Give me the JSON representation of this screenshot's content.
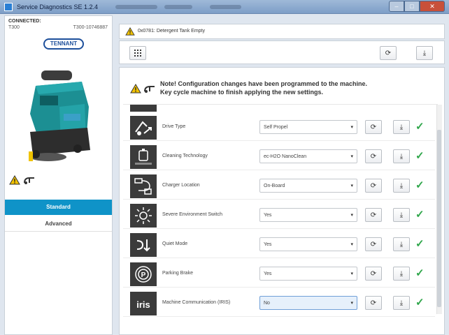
{
  "window": {
    "title": "Service Diagnostics SE 1.2.4"
  },
  "connection": {
    "label": "CONNECTED:",
    "model": "T300",
    "serial": "T300-10746887"
  },
  "brand": {
    "logo_text": "TENNANT"
  },
  "nav": {
    "standard": "Standard",
    "advanced": "Advanced",
    "active": "Standard"
  },
  "alert": {
    "text": "0x0781: Detergent Tank Empty",
    "icon": "warning-icon"
  },
  "note": {
    "line1": "Note! Configuration changes have been programmed to the machine.",
    "line2": "Key cycle machine to finish applying the new settings."
  },
  "settings": [
    {
      "label": "Drive Type",
      "value": "Self Propel",
      "icon": "drive-icon",
      "status": "ok"
    },
    {
      "label": "Cleaning Technology",
      "value": "ec-H2O NanoClean",
      "icon": "ec-h2o-icon",
      "status": "ok"
    },
    {
      "label": "Charger Location",
      "value": "On-Board",
      "icon": "charger-icon",
      "status": "ok"
    },
    {
      "label": "Severe Environment Switch",
      "value": "Yes",
      "icon": "severe-env-icon",
      "status": "ok"
    },
    {
      "label": "Quiet Mode",
      "value": "Yes",
      "icon": "quiet-mode-icon",
      "status": "ok"
    },
    {
      "label": "Parking Brake",
      "value": "Yes",
      "icon": "parking-brake-icon",
      "status": "ok"
    },
    {
      "label": "Machine Communication (IRIS)",
      "value": "No",
      "icon": "iris-icon",
      "status": "ok"
    }
  ],
  "colors": {
    "accent": "#0f93c8",
    "check": "#2fa64a",
    "warning": "#f2c200"
  }
}
